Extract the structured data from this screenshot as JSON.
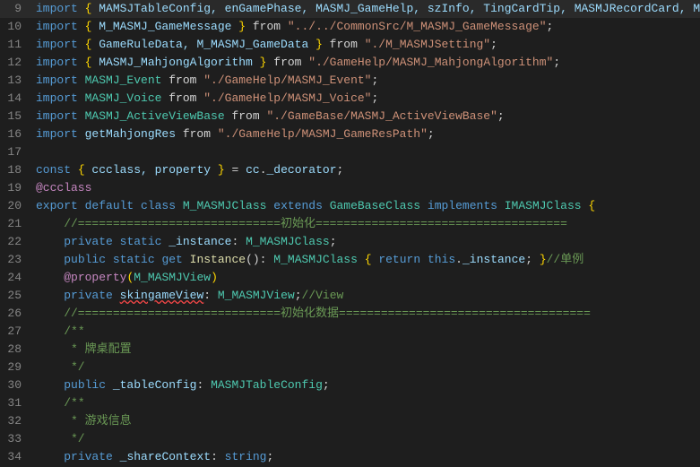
{
  "lines": [
    {
      "number": 9,
      "tokens": [
        {
          "text": "import ",
          "cls": "kw"
        },
        {
          "text": "{",
          "cls": "bracket"
        },
        {
          "text": " MAMSJTableConfig, enGamePhase, MASMJ_GameHelp, szInfo, TingCardTip, MASMJRecordCard, M",
          "cls": "var"
        },
        {
          "text": "...",
          "cls": "comment"
        }
      ]
    },
    {
      "number": 10,
      "tokens": [
        {
          "text": "import ",
          "cls": "kw"
        },
        {
          "text": "{",
          "cls": "bracket"
        },
        {
          "text": " M_MASMJ_GameMessage ",
          "cls": "var"
        },
        {
          "text": "}",
          "cls": "bracket"
        },
        {
          "text": " from ",
          "cls": "from"
        },
        {
          "text": "\"../../CommonSrc/M_MASMJ_GameMessage\"",
          "cls": "str"
        },
        {
          "text": ";",
          "cls": "punct"
        }
      ]
    },
    {
      "number": 11,
      "tokens": [
        {
          "text": "import ",
          "cls": "kw"
        },
        {
          "text": "{",
          "cls": "bracket"
        },
        {
          "text": " GameRuleData, M_MASMJ_GameData ",
          "cls": "var"
        },
        {
          "text": "}",
          "cls": "bracket"
        },
        {
          "text": " from ",
          "cls": "from"
        },
        {
          "text": "\"./M_MASMJSetting\"",
          "cls": "str"
        },
        {
          "text": ";",
          "cls": "punct"
        }
      ]
    },
    {
      "number": 12,
      "tokens": [
        {
          "text": "import ",
          "cls": "kw"
        },
        {
          "text": "{",
          "cls": "bracket"
        },
        {
          "text": " MASMJ_MahjongAlgorithm ",
          "cls": "var"
        },
        {
          "text": "}",
          "cls": "bracket"
        },
        {
          "text": " from ",
          "cls": "from"
        },
        {
          "text": "\"./GameHelp/MASMJ_MahjongAlgorithm\"",
          "cls": "str"
        },
        {
          "text": ";",
          "cls": "punct"
        }
      ]
    },
    {
      "number": 13,
      "tokens": [
        {
          "text": "import ",
          "cls": "kw"
        },
        {
          "text": "MASMJ_Event ",
          "cls": "type"
        },
        {
          "text": "from ",
          "cls": "from"
        },
        {
          "text": "\"./GameHelp/MASMJ_Event\"",
          "cls": "str"
        },
        {
          "text": ";",
          "cls": "punct"
        }
      ]
    },
    {
      "number": 14,
      "tokens": [
        {
          "text": "import ",
          "cls": "kw"
        },
        {
          "text": "MASMJ_Voice ",
          "cls": "type"
        },
        {
          "text": "from ",
          "cls": "from"
        },
        {
          "text": "\"./GameHelp/MASMJ_Voice\"",
          "cls": "str"
        },
        {
          "text": ";",
          "cls": "punct"
        }
      ]
    },
    {
      "number": 15,
      "tokens": [
        {
          "text": "import ",
          "cls": "kw"
        },
        {
          "text": "MASMJ_ActiveViewBase ",
          "cls": "type"
        },
        {
          "text": "from ",
          "cls": "from"
        },
        {
          "text": "\"./GameBase/MASMJ_ActiveViewBase\"",
          "cls": "str"
        },
        {
          "text": ";",
          "cls": "punct"
        }
      ]
    },
    {
      "number": 16,
      "tokens": [
        {
          "text": "import ",
          "cls": "kw"
        },
        {
          "text": "getMahjongRes ",
          "cls": "var"
        },
        {
          "text": "from ",
          "cls": "from"
        },
        {
          "text": "\"./GameHelp/MASMJ_GameResPath\"",
          "cls": "str"
        },
        {
          "text": ";",
          "cls": "punct"
        }
      ]
    },
    {
      "number": 17,
      "tokens": [
        {
          "text": "",
          "cls": ""
        }
      ]
    },
    {
      "number": 18,
      "tokens": [
        {
          "text": "const ",
          "cls": "kw"
        },
        {
          "text": "{",
          "cls": "bracket"
        },
        {
          "text": " ccclass, property ",
          "cls": "var"
        },
        {
          "text": "}",
          "cls": "bracket"
        },
        {
          "text": " = ",
          "cls": "eq"
        },
        {
          "text": "cc",
          "cls": "var"
        },
        {
          "text": ".",
          "cls": "punct"
        },
        {
          "text": "_decorator",
          "cls": "var"
        },
        {
          "text": ";",
          "cls": "punct"
        }
      ]
    },
    {
      "number": 19,
      "tokens": [
        {
          "text": "@ccclass",
          "cls": "decorator"
        }
      ]
    },
    {
      "number": 20,
      "tokens": [
        {
          "text": "export ",
          "cls": "kw"
        },
        {
          "text": "default ",
          "cls": "kw"
        },
        {
          "text": "class ",
          "cls": "kw"
        },
        {
          "text": "M_MASMJClass ",
          "cls": "type"
        },
        {
          "text": "extends ",
          "cls": "kw"
        },
        {
          "text": "GameBaseClass ",
          "cls": "type"
        },
        {
          "text": "implements ",
          "cls": "kw"
        },
        {
          "text": "IMASMJClass ",
          "cls": "type"
        },
        {
          "text": "{",
          "cls": "bracket"
        }
      ]
    },
    {
      "number": 21,
      "tokens": [
        {
          "text": "    //=============================初始化====================================",
          "cls": "chinese-comment"
        }
      ]
    },
    {
      "number": 22,
      "tokens": [
        {
          "text": "    ",
          "cls": ""
        },
        {
          "text": "private ",
          "cls": "kw"
        },
        {
          "text": "static ",
          "cls": "kw"
        },
        {
          "text": "_instance",
          "cls": "var"
        },
        {
          "text": ": ",
          "cls": "punct"
        },
        {
          "text": "M_MASMJClass",
          "cls": "type"
        },
        {
          "text": ";",
          "cls": "punct"
        }
      ]
    },
    {
      "number": 23,
      "tokens": [
        {
          "text": "    ",
          "cls": ""
        },
        {
          "text": "public ",
          "cls": "kw"
        },
        {
          "text": "static ",
          "cls": "kw"
        },
        {
          "text": "get ",
          "cls": "kw"
        },
        {
          "text": "Instance",
          "cls": "fn"
        },
        {
          "text": "(): ",
          "cls": "punct"
        },
        {
          "text": "M_MASMJClass ",
          "cls": "type"
        },
        {
          "text": "{",
          "cls": "bracket"
        },
        {
          "text": " return ",
          "cls": "kw"
        },
        {
          "text": "this",
          "cls": "kw"
        },
        {
          "text": ".",
          "cls": "punct"
        },
        {
          "text": "_instance",
          "cls": "var"
        },
        {
          "text": "; ",
          "cls": "punct"
        },
        {
          "text": "}",
          "cls": "bracket"
        },
        {
          "text": "//单例",
          "cls": "chinese-comment"
        }
      ]
    },
    {
      "number": 24,
      "tokens": [
        {
          "text": "    ",
          "cls": ""
        },
        {
          "text": "@property",
          "cls": "decorator"
        },
        {
          "text": "(",
          "cls": "bracket"
        },
        {
          "text": "M_MASMJView",
          "cls": "type"
        },
        {
          "text": ")",
          "cls": "bracket"
        }
      ]
    },
    {
      "number": 25,
      "tokens": [
        {
          "text": "    ",
          "cls": ""
        },
        {
          "text": "private ",
          "cls": "kw"
        },
        {
          "text": "skingameView",
          "cls": "var",
          "underline": true
        },
        {
          "text": ": ",
          "cls": "punct"
        },
        {
          "text": "M_MASMJView",
          "cls": "type"
        },
        {
          "text": ";",
          "cls": "punct"
        },
        {
          "text": "//View",
          "cls": "chinese-comment"
        }
      ]
    },
    {
      "number": 26,
      "tokens": [
        {
          "text": "    //=============================初始化数据====================================",
          "cls": "chinese-comment"
        }
      ]
    },
    {
      "number": 27,
      "tokens": [
        {
          "text": "    ",
          "cls": ""
        },
        {
          "text": "/**",
          "cls": "comment"
        }
      ]
    },
    {
      "number": 28,
      "tokens": [
        {
          "text": "     * ",
          "cls": "comment"
        },
        {
          "text": "牌桌配置",
          "cls": "comment"
        }
      ]
    },
    {
      "number": 29,
      "tokens": [
        {
          "text": "     */",
          "cls": "comment"
        }
      ]
    },
    {
      "number": 30,
      "tokens": [
        {
          "text": "    ",
          "cls": ""
        },
        {
          "text": "public ",
          "cls": "kw"
        },
        {
          "text": "_tableConfig",
          "cls": "var"
        },
        {
          "text": ": ",
          "cls": "punct"
        },
        {
          "text": "MASMJTableConfig",
          "cls": "type"
        },
        {
          "text": ";",
          "cls": "punct"
        }
      ]
    },
    {
      "number": 31,
      "tokens": [
        {
          "text": "    ",
          "cls": ""
        },
        {
          "text": "/**",
          "cls": "comment"
        }
      ]
    },
    {
      "number": 32,
      "tokens": [
        {
          "text": "     * ",
          "cls": "comment"
        },
        {
          "text": "游戏信息",
          "cls": "comment"
        }
      ]
    },
    {
      "number": 33,
      "tokens": [
        {
          "text": "     */",
          "cls": "comment"
        }
      ]
    },
    {
      "number": 34,
      "tokens": [
        {
          "text": "    ",
          "cls": ""
        },
        {
          "text": "private ",
          "cls": "kw"
        },
        {
          "text": "_shareContext",
          "cls": "var"
        },
        {
          "text": ": ",
          "cls": "punct"
        },
        {
          "text": "string",
          "cls": "kw"
        },
        {
          "text": ";",
          "cls": "punct"
        }
      ]
    }
  ]
}
